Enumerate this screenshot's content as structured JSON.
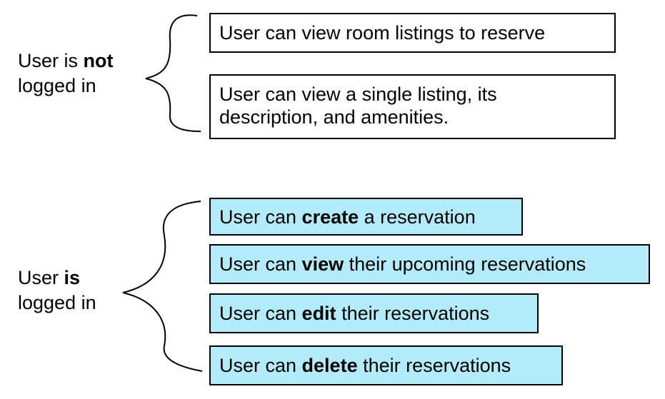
{
  "group_not_logged_in": {
    "label_line1_prefix": "User is ",
    "label_line1_bold": "not",
    "label_line2": "logged in",
    "items": [
      {
        "text": "User can view room listings to reserve"
      },
      {
        "line1": "User can view a single listing, its",
        "line2": "description, and amenities."
      }
    ]
  },
  "group_logged_in": {
    "label_line1_prefix": "User ",
    "label_line1_bold": "is",
    "label_line2": "logged in",
    "items": [
      {
        "prefix": "User can ",
        "bold": "create",
        "suffix": " a reservation"
      },
      {
        "prefix": "User can ",
        "bold": "view",
        "suffix": " their upcoming reservations"
      },
      {
        "prefix": "User can ",
        "bold": "edit",
        "suffix": " their reservations"
      },
      {
        "prefix": "User can ",
        "bold": "delete",
        "suffix": " their reservations"
      }
    ]
  },
  "colors": {
    "logged_in_box_fill": "#b3ebfa",
    "logged_out_box_fill": "#ffffff",
    "stroke": "#000000"
  }
}
